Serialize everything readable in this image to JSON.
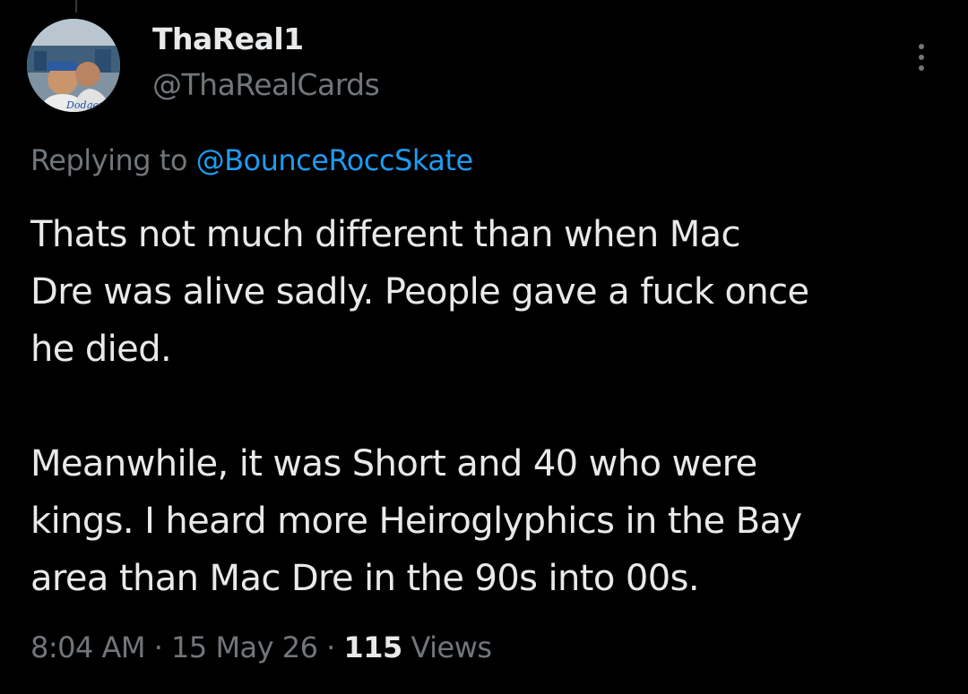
{
  "author": {
    "display_name": "ThaReal1",
    "handle": "@ThaRealCards"
  },
  "reply": {
    "prefix": "Replying to",
    "mention": "@BounceRoccSkate"
  },
  "tweet": {
    "lines": [
      "Thats not much different than when Mac",
      "Dre was alive sadly. People gave a fuck once",
      "he died.",
      "",
      "Meanwhile, it was Short and 40 who were",
      "kings. I heard more Heiroglyphics in the Bay",
      "area than Mac Dre in the 90s into 00s."
    ]
  },
  "meta": {
    "time": "8:04 AM",
    "separator": "·",
    "date": "15 May 26",
    "views_count": "115",
    "views_label": "Views"
  },
  "icons": {
    "more": "more-options-icon",
    "avatar": "profile-photo"
  },
  "colors": {
    "background": "#000000",
    "text_primary": "#e7e9ea",
    "text_secondary": "#71767b",
    "link": "#1d9bf0"
  }
}
